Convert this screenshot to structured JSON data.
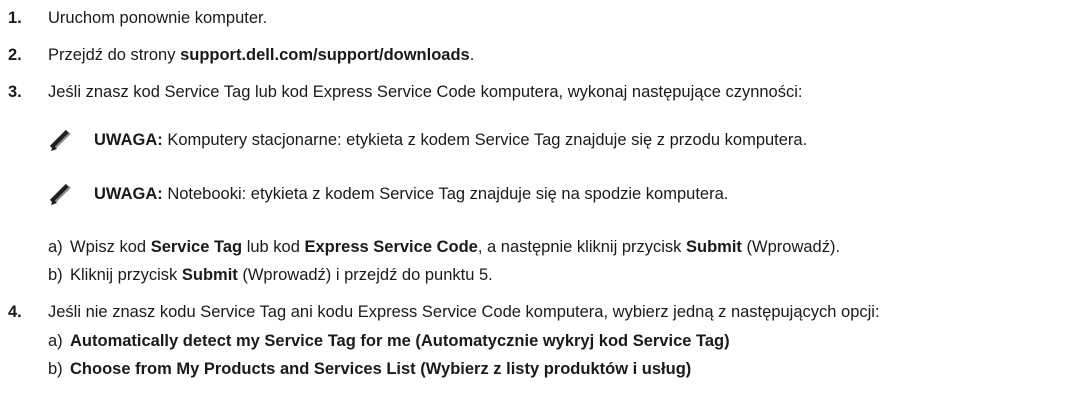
{
  "steps": [
    {
      "num": "1.",
      "parts": [
        "Uruchom ponownie komputer."
      ]
    },
    {
      "num": "2.",
      "before": "Przejdź do strony ",
      "link": "support.dell.com/support/downloads",
      "after": "."
    },
    {
      "num": "3.",
      "text": "Jeśli znasz kod Service Tag lub kod Express Service Code komputera, wykonaj następujące czynności:",
      "notes": [
        {
          "label": "UWAGA:",
          "text": " Komputery stacjonarne: etykieta z kodem Service Tag znajduje się z przodu komputera."
        },
        {
          "label": "UWAGA:",
          "text": " Notebooki: etykieta z kodem Service Tag znajduje się na spodzie komputera."
        }
      ],
      "sub": [
        {
          "letter": "a)",
          "t1": "Wpisz kod ",
          "b1": "Service Tag",
          "t2": " lub kod ",
          "b2": "Express Service Code",
          "t3": ", a następnie kliknij przycisk ",
          "b3": "Submit",
          "t4": " (Wprowadź)."
        },
        {
          "letter": "b)",
          "t1": "Kliknij przycisk ",
          "b1": "Submit",
          "t2": " (Wprowadź) i przejdź do punktu 5."
        }
      ]
    },
    {
      "num": "4.",
      "text": "Jeśli nie znasz kodu Service Tag ani kodu Express Service Code komputera, wybierz jedną z następujących opcji:",
      "sub": [
        {
          "letter": "a)",
          "bold": "Automatically detect my Service Tag for me (Automatycznie wykryj kod Service Tag)"
        },
        {
          "letter": "b)",
          "bold": "Choose from My Products and Services List (Wybierz z listy produktów i usług)"
        }
      ]
    }
  ],
  "icons": {
    "note": "pencil-note-icon"
  }
}
